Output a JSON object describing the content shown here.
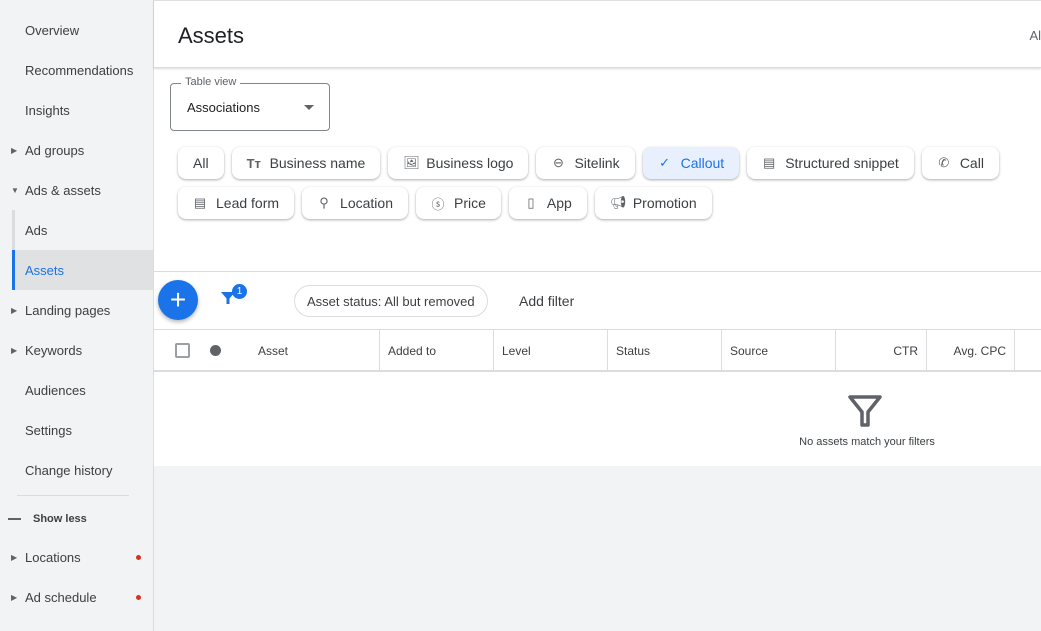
{
  "sidebar": {
    "items": [
      {
        "label": "Overview"
      },
      {
        "label": "Recommendations"
      },
      {
        "label": "Insights"
      },
      {
        "label": "Ad groups"
      },
      {
        "label": "Ads & assets"
      },
      {
        "label": "Ads"
      },
      {
        "label": "Assets"
      },
      {
        "label": "Landing pages"
      },
      {
        "label": "Keywords"
      },
      {
        "label": "Audiences"
      },
      {
        "label": "Settings"
      },
      {
        "label": "Change history"
      }
    ],
    "show_less": "Show less",
    "locations": "Locations",
    "ad_schedule": "Ad schedule"
  },
  "header": {
    "title": "Assets",
    "right_text": "Al"
  },
  "table_view": {
    "label": "Table view",
    "value": "Associations"
  },
  "chips": [
    "All",
    "Business name",
    "Business logo",
    "Sitelink",
    "Callout",
    "Structured snippet",
    "Call",
    "Lead form",
    "Location",
    "Price",
    "App",
    "Promotion"
  ],
  "toolbar": {
    "filter_count": "1",
    "status_filter": "Asset status: All but removed",
    "add_filter": "Add filter"
  },
  "columns": [
    "Asset",
    "Added to",
    "Level",
    "Status",
    "Source",
    "CTR",
    "Avg. CPC"
  ],
  "empty": "No assets match your filters",
  "colors": {
    "accent": "#1a73e8",
    "alert": "#d93025"
  }
}
